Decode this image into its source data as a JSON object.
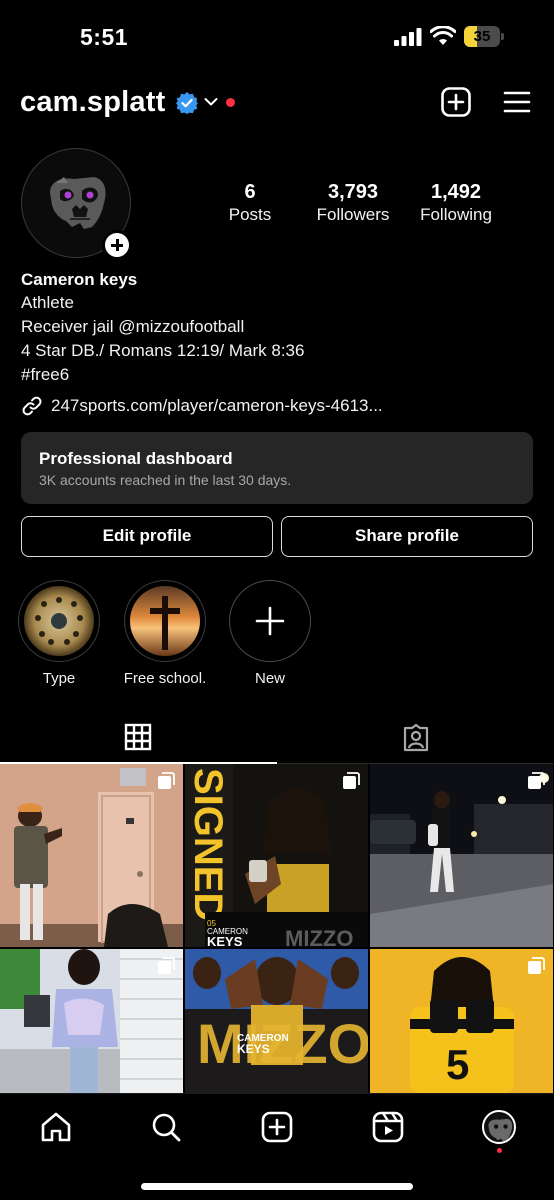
{
  "status_bar": {
    "time": "5:51",
    "battery_level": "35",
    "battery_fraction": 0.35,
    "battery_color": "#f5d33b"
  },
  "header": {
    "username": "cam.splatt",
    "verified": true,
    "verified_color": "#3897f0",
    "notification_dot_color": "#ff3040",
    "icons": [
      "create-icon",
      "menu-icon"
    ]
  },
  "profile": {
    "stats": [
      {
        "value": "6",
        "label": "Posts"
      },
      {
        "value": "3,793",
        "label": "Followers"
      },
      {
        "value": "1,492",
        "label": "Following"
      }
    ],
    "name": "Cameron keys",
    "category": "Athlete",
    "bio_lines": [
      "Receiver jail @mizzoufootball",
      "4 Star DB./ Romans 12:19/ Mark 8:36",
      "#free6"
    ],
    "link": "247sports.com/player/cameron-keys-4613..."
  },
  "dashboard": {
    "title": "Professional dashboard",
    "subtitle": "3K accounts reached in the last 30 days."
  },
  "buttons": {
    "edit_profile": "Edit profile",
    "share_profile": "Share profile"
  },
  "highlights": [
    {
      "label": "Type"
    },
    {
      "label": "Free school."
    },
    {
      "label": "New"
    }
  ],
  "tabs": [
    "grid-icon",
    "tagged-icon"
  ],
  "posts": [
    {
      "kind": "photo",
      "multi": true
    },
    {
      "kind": "graphic",
      "text": [
        "SIGNED",
        "05",
        "CAMERON",
        "KEYS",
        "MIZZO"
      ],
      "multi": true
    },
    {
      "kind": "photo",
      "multi": true
    },
    {
      "kind": "photo",
      "multi": true
    },
    {
      "kind": "graphic",
      "text": [
        "CAMERON",
        "KEYS",
        "MIZZOU"
      ],
      "multi": false
    },
    {
      "kind": "photo",
      "multi": true
    }
  ],
  "bottom_nav": [
    "home-icon",
    "search-icon",
    "create-icon",
    "reels-icon",
    "profile-icon"
  ]
}
